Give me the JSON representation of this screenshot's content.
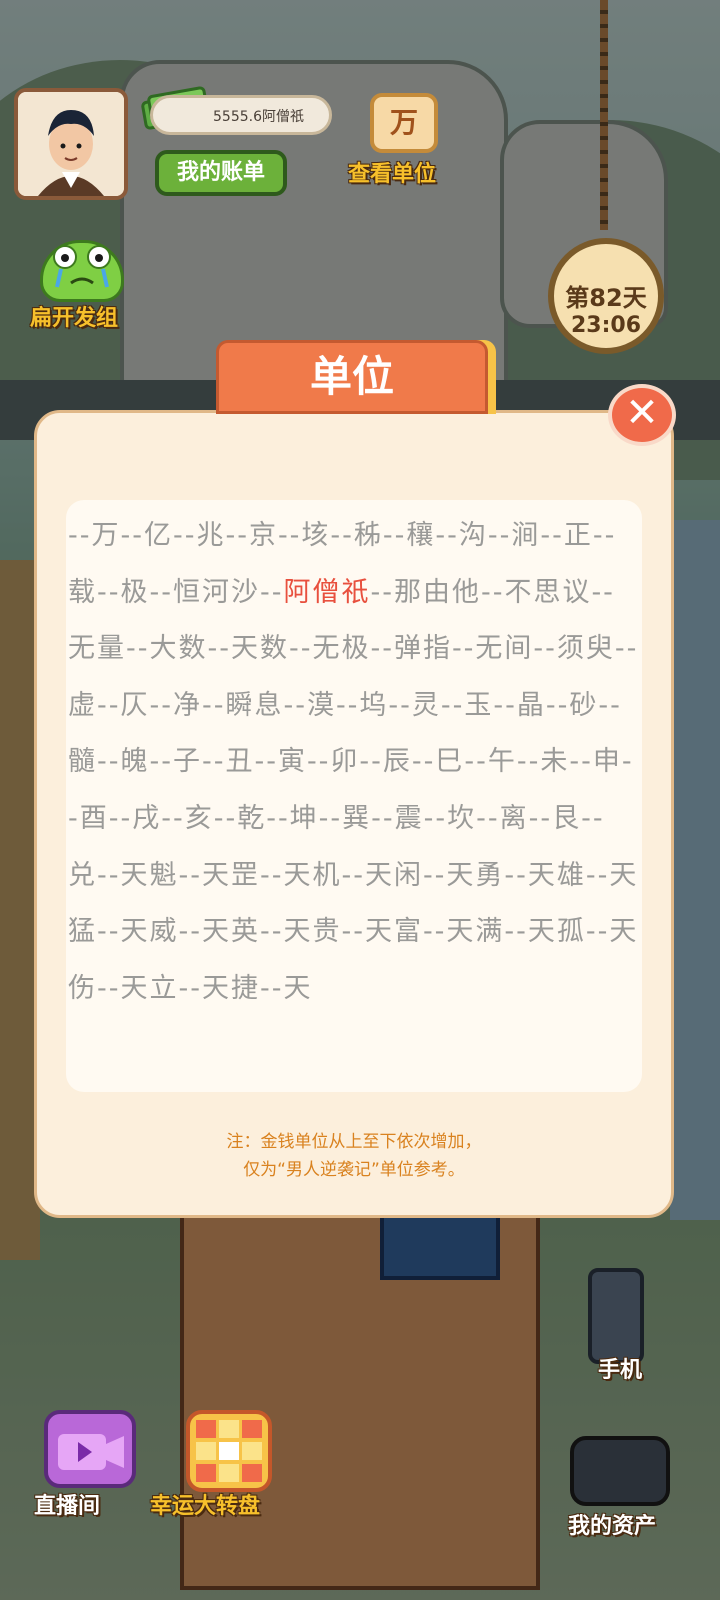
{
  "hud": {
    "money_text": "5555.6阿僧祇",
    "bill_button": "我的账单",
    "unit_tile_char": "万",
    "view_units_label": "查看单位",
    "group_label": "扁开发组",
    "day_label": "第82天",
    "time_label": "23:06"
  },
  "modal": {
    "title": "单位",
    "close_symbol": "✕",
    "units_before_highlight": "--万--亿--兆--京--垓--秭--穰--沟--涧--正--载--极--恒河沙--",
    "highlighted_unit": "阿僧祇",
    "units_after_highlight": "--那由他--不思议--无量--大数--天数--无极--弹指--无间--须臾--虚--仄--净--瞬息--漠--坞--灵--玉--晶--砂--髓--魄--子--丑--寅--卯--辰--巳--午--未--申--酉--戌--亥--乾--坤--巽--震--坎--离--艮--兑--天魁--天罡--天机--天闲--天勇--天雄--天猛--天威--天英--天贵--天富--天满--天孤--天伤--天立--天捷--天",
    "note_line1": "注：金钱单位从上至下依次增加，",
    "note_line2": "仅为“男人逆袭记”单位参考。"
  },
  "bottom": {
    "phone_label": "手机",
    "live_label": "直播间",
    "wheel_label": "幸运大转盘",
    "assets_label": "我的资产"
  },
  "colors": {
    "accent_orange": "#f07a4a",
    "highlight_red": "#e8503e",
    "note_orange": "#d9821f",
    "button_green": "#6cb13a"
  }
}
